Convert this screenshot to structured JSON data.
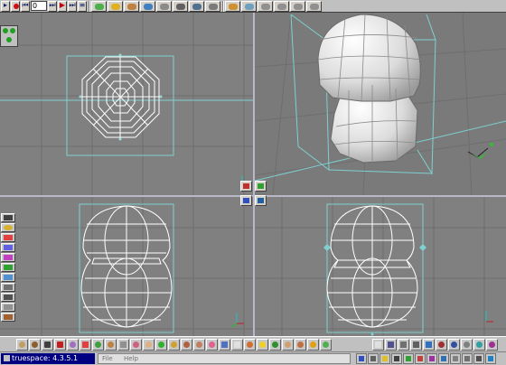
{
  "app": {
    "title": "truespace: 4.3.5.1",
    "menu": [
      "File",
      "Help"
    ]
  },
  "toolbar": {
    "frame_value": "0"
  },
  "viewports": [
    {
      "name": "top"
    },
    {
      "name": "perspective"
    },
    {
      "name": "front"
    },
    {
      "name": "side"
    }
  ],
  "colors": {
    "viewport_bg": "#808080",
    "grid": "#6e6e6e",
    "guide": "#7fd0d0",
    "wire": "#ffffff",
    "divider": "#b8b8c8",
    "title_bar": "#000080"
  }
}
